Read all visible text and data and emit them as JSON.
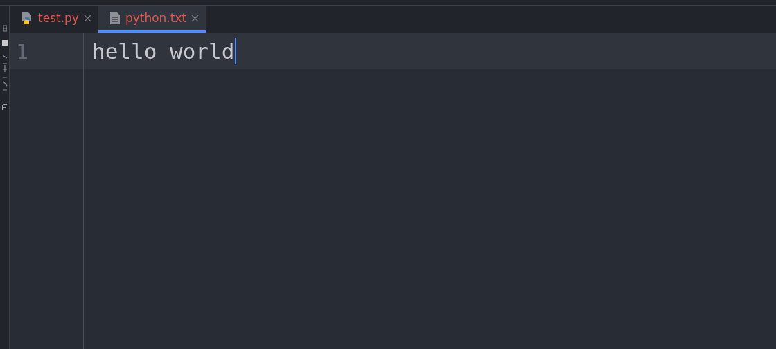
{
  "tabs": [
    {
      "label": "test.py",
      "kind": "python",
      "selected": false
    },
    {
      "label": "python.txt",
      "kind": "text",
      "selected": true
    }
  ],
  "editor": {
    "lines": [
      {
        "number": "1",
        "text": "hello world",
        "current": true
      }
    ]
  }
}
